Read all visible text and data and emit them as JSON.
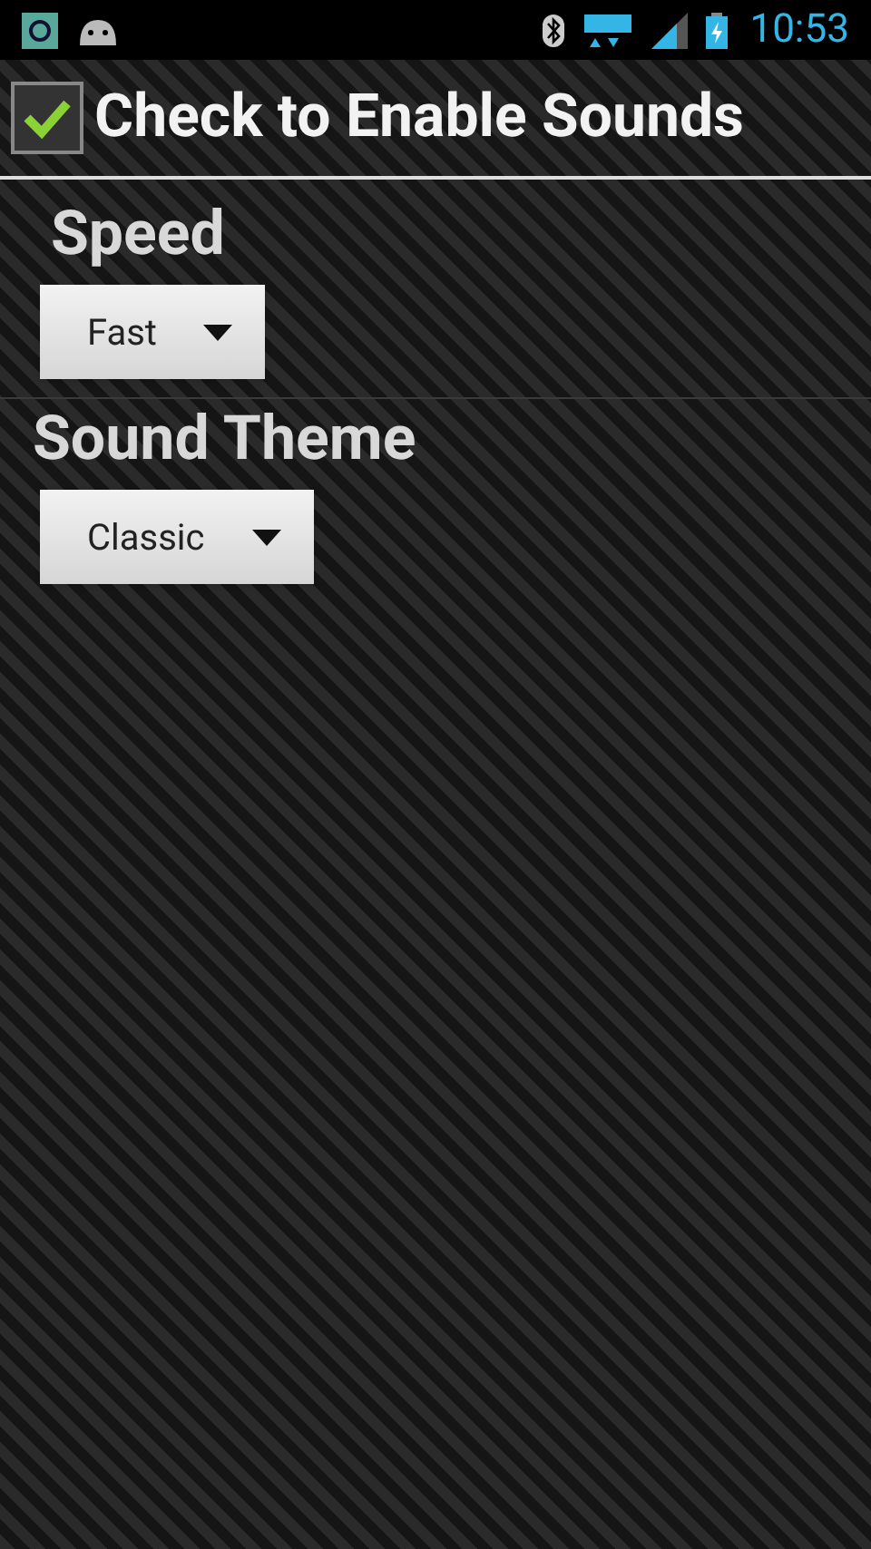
{
  "status_bar": {
    "time": "10:53"
  },
  "enable_sounds": {
    "label": "Check to Enable Sounds",
    "checked": true
  },
  "settings": [
    {
      "label": "Speed",
      "value": "Fast"
    },
    {
      "label": "Sound Theme",
      "value": "Classic"
    }
  ]
}
